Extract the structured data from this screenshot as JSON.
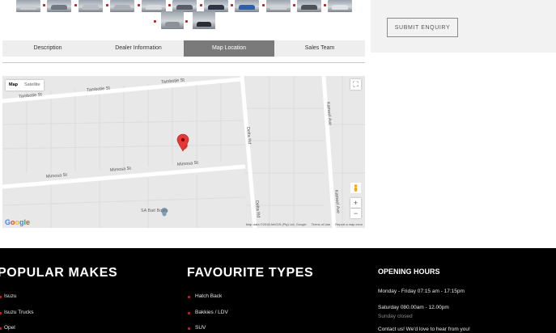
{
  "thumbnails": {
    "count": 14,
    "colors": [
      "#c9cdd2",
      "#6f7780",
      "#b9bec4",
      "#aab0b8",
      "#d7dbe0",
      "#585f68",
      "#2c3446",
      "#2f5fa8",
      "#cfd3d8",
      "#4b525b",
      "#e0e3e6",
      "#3c4048",
      "#8b9099",
      "#2a2e34"
    ]
  },
  "enquiry": {
    "button_label": "SUBMIT ENQUIRY"
  },
  "tabs": [
    {
      "label": "Description"
    },
    {
      "label": "Dealer Information"
    },
    {
      "label": "Map Location",
      "active": true
    },
    {
      "label": "Sales Team"
    }
  ],
  "map": {
    "type_controls": {
      "map": "Map",
      "satellite": "Satellite"
    },
    "streets": {
      "tambotie_left": "Tambotie St",
      "tambotie_mid": "Tambotie St",
      "tambotie_right": "Tambotie St",
      "mimosa_left": "Mimosa St",
      "mimosa_mid": "Mimosa St",
      "mimosa_right": "Mimosa St",
      "delta_top": "Delta Rd",
      "delta_bottom": "Delta Rd",
      "kameel_top": "Kameel Ave",
      "kameel_bottom": "Kameel Ave"
    },
    "poi": "SA Bait Boats",
    "logo": "Google",
    "attribution": {
      "data": "Map data ©2018 AfriGIS (Pty) Ltd, Google",
      "terms": "Terms of Use",
      "report": "Report a map error"
    },
    "zoom_in": "+",
    "zoom_out": "−",
    "marker_color": "#e53935"
  },
  "footer": {
    "popular_makes": {
      "title": "POPULAR MAKES",
      "items": [
        "Isuzu",
        "Isuzu Trucks",
        "Opel"
      ]
    },
    "favourite_types": {
      "title": "FAVOURITE TYPES",
      "items": [
        "Hatch Back",
        "Bakkies / LDV",
        "SUV"
      ]
    },
    "opening_hours": {
      "title": "OPENING HOURS",
      "weekday": "Monday - Friday 07:15 am - 17:15pm",
      "saturday": "Saturday 080.00am - 12.00pm",
      "sunday": "Sunday closed",
      "contact": "Contact us! We'd love to hear from you!"
    }
  },
  "colors": {
    "accent": "#d11a1a",
    "tab_active": "#7a7a7a",
    "footer_bg": "#000000"
  }
}
